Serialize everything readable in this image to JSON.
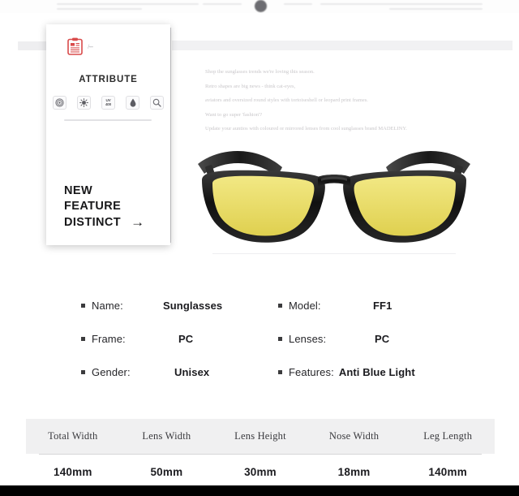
{
  "header": {
    "badge_icon": "dark-circle-badge"
  },
  "attribute_card": {
    "clipboard_icon": "clipboard-icon",
    "clipboard_note": "/---",
    "title": "ATTRIBUTE",
    "icons": [
      {
        "name": "target-icon",
        "label": ""
      },
      {
        "name": "sun-icon",
        "label": ""
      },
      {
        "name": "uv400-icon",
        "label_line1": "UV",
        "label_line2": "400"
      },
      {
        "name": "droplet-icon",
        "label": ""
      },
      {
        "name": "magnifier-icon",
        "label": ""
      }
    ],
    "headline_line1": "NEW",
    "headline_line2": "FEATURE",
    "headline_line3": "DISTINCT",
    "headline_arrow": "→"
  },
  "description": {
    "lines": [
      "Shop the sunglasses trends we're loving this season.",
      "Retro shapes are big news - think cat-eyes,",
      "aviators and oversized round styles with tortoiseshell or leopard print frames.",
      "Want to go super 'fashion'?",
      "Update your auntios with coloured or mirrored lenses from cool sunglasses brand MADELINY."
    ]
  },
  "product_image": {
    "name": "sunglasses-photo",
    "frame_color": "#1b1b1b",
    "lens_color": "#ecdf63"
  },
  "specs": {
    "rows": [
      {
        "left": {
          "label": "Name:",
          "value": "Sunglasses"
        },
        "right": {
          "label": "Model:",
          "value": "FF1"
        }
      },
      {
        "left": {
          "label": "Frame:",
          "value": "PC"
        },
        "right": {
          "label": "Lenses:",
          "value": "PC"
        }
      },
      {
        "left": {
          "label": "Gender:",
          "value": "Unisex"
        },
        "right": {
          "label": "Features:",
          "value": "Anti Blue Light"
        }
      }
    ]
  },
  "measurements": {
    "headers": [
      "Total Width",
      "Lens Width",
      "Lens Height",
      "Nose Width",
      "Leg Length"
    ],
    "values": [
      "140mm",
      "50mm",
      "30mm",
      "18mm",
      "140mm"
    ]
  }
}
